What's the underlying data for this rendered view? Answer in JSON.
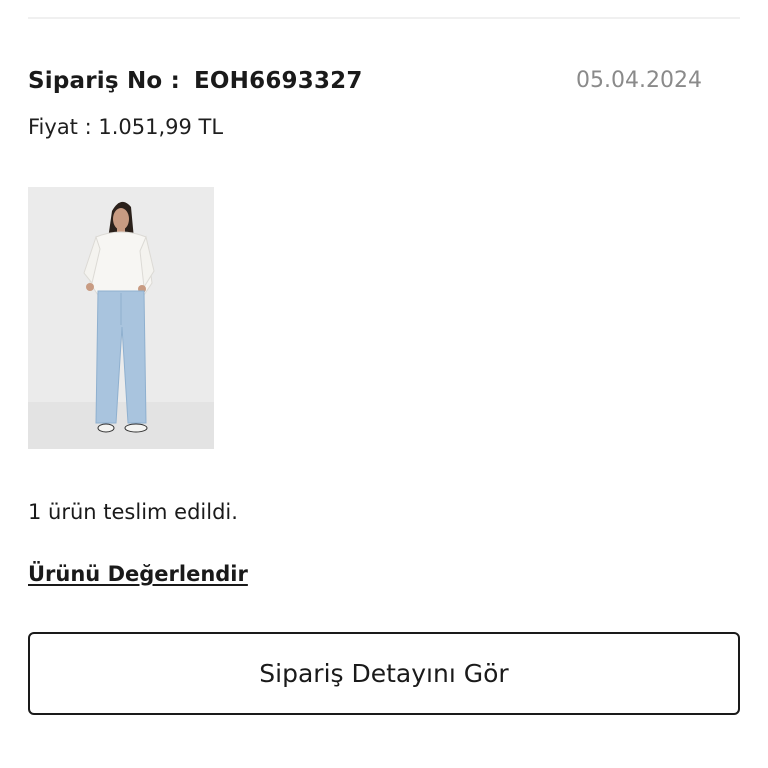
{
  "order": {
    "number_label": "Sipariş No :",
    "number": "EOH6693327",
    "date": "05.04.2024",
    "price_label": "Fiyat :",
    "price": "1.051,99 TL"
  },
  "product": {
    "image_icon": "product-photo-woman-jeans"
  },
  "status": {
    "delivered_text": "1 ürün teslim edildi."
  },
  "actions": {
    "review_label": "Ürünü Değerlendir",
    "details_label": "Sipariş Detayını Gör"
  },
  "colors": {
    "text": "#1a1a1a",
    "muted": "#8a8a8a",
    "divider": "#f0f0f0",
    "button_border": "#1a1a1a"
  }
}
